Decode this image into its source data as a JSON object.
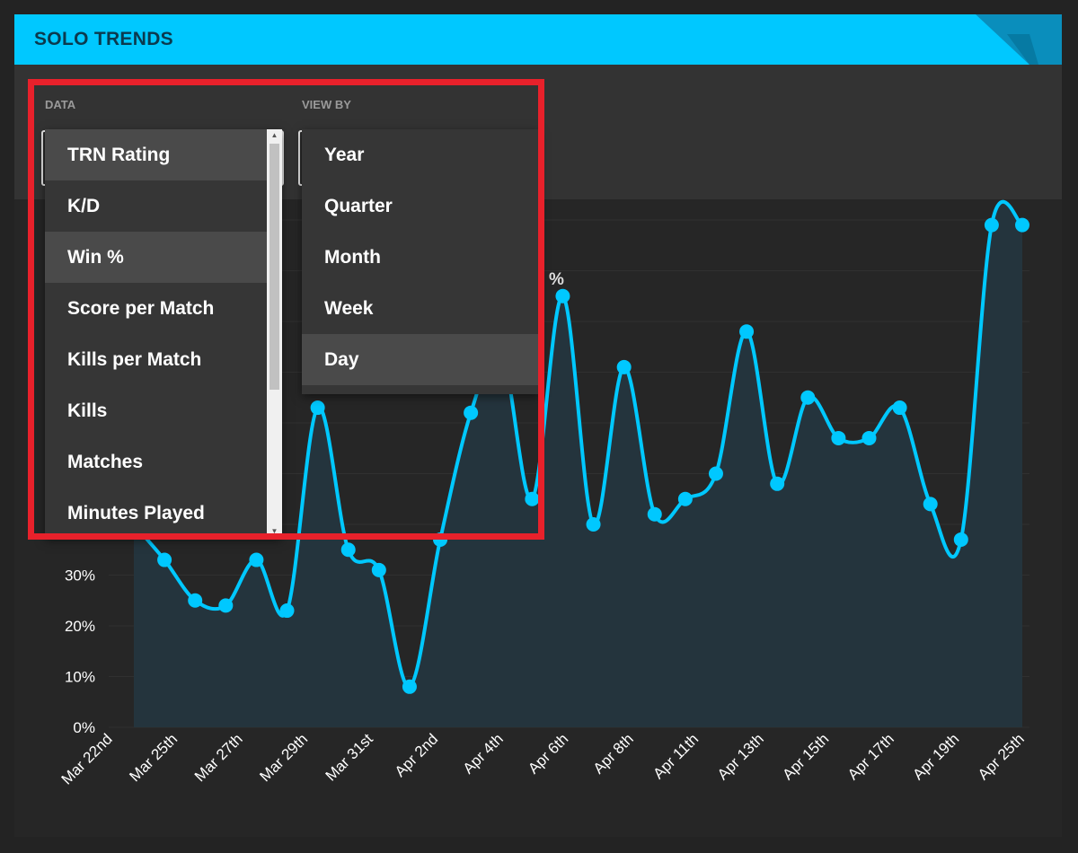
{
  "header": {
    "title": "SOLO TRENDS"
  },
  "controls": {
    "data_label": "DATA",
    "view_by_label": "VIEW BY"
  },
  "data_dropdown": {
    "items": [
      "TRN Rating",
      "K/D",
      "Win %",
      "Score per Match",
      "Kills per Match",
      "Kills",
      "Matches",
      "Minutes Played"
    ],
    "highlighted": [
      "TRN Rating",
      "Win %"
    ]
  },
  "view_by_dropdown": {
    "items": [
      "Year",
      "Quarter",
      "Month",
      "Week",
      "Day"
    ],
    "highlighted": [
      "Day"
    ]
  },
  "chart_peek_label": "%",
  "colors": {
    "accent": "#00c8ff",
    "header_text": "#0b3a4e",
    "highlight_border": "#e8212b",
    "area_fill": "#24343d"
  },
  "chart_data": {
    "type": "area",
    "y_tick_labels": [
      "0%",
      "10%",
      "20%",
      "30%"
    ],
    "ylim": [
      0,
      100
    ],
    "grid": true,
    "x_tick_labels": [
      "Mar 22nd",
      "Mar 25th",
      "Mar 27th",
      "Mar 29th",
      "Mar 31st",
      "Apr 2nd",
      "Apr 4th",
      "Apr 6th",
      "Apr 8th",
      "Apr 11th",
      "Apr 13th",
      "Apr 15th",
      "Apr 17th",
      "Apr 19th",
      "Apr 25th"
    ],
    "values": [
      40,
      33,
      25,
      24,
      33,
      23,
      63,
      35,
      31,
      8,
      37,
      62,
      74,
      45,
      85,
      40,
      71,
      42,
      45,
      50,
      78,
      48,
      65,
      57,
      57,
      63,
      44,
      37,
      99,
      99
    ]
  }
}
